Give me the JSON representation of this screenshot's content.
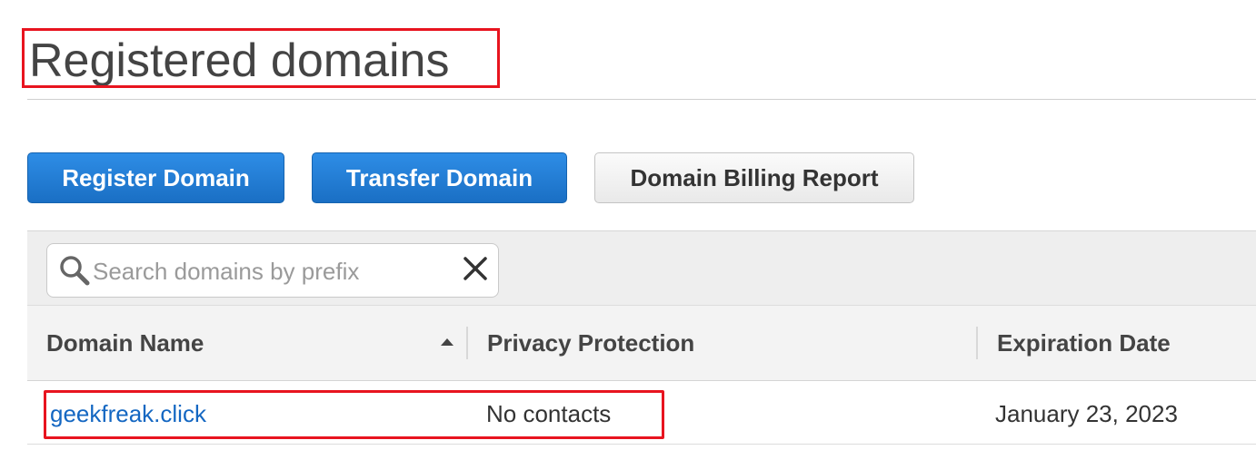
{
  "page": {
    "title": "Registered domains"
  },
  "toolbar": {
    "register_label": "Register Domain",
    "transfer_label": "Transfer Domain",
    "billing_label": "Domain Billing Report"
  },
  "search": {
    "placeholder": "Search domains by prefix",
    "value": ""
  },
  "table": {
    "columns": [
      "Domain Name",
      "Privacy Protection",
      "Expiration Date"
    ],
    "sort": {
      "column": "Domain Name",
      "direction": "ascending"
    },
    "rows": [
      {
        "domain": "geekfreak.click",
        "privacy": "No contacts",
        "expiration": "January 23, 2023"
      }
    ]
  },
  "colors": {
    "primary_button": "#1a6fc4",
    "link": "#1467c2",
    "highlight_box": "#e8141f"
  },
  "icons": {
    "search": "search-icon",
    "clear": "close-icon",
    "sort": "sort-ascending-icon"
  }
}
